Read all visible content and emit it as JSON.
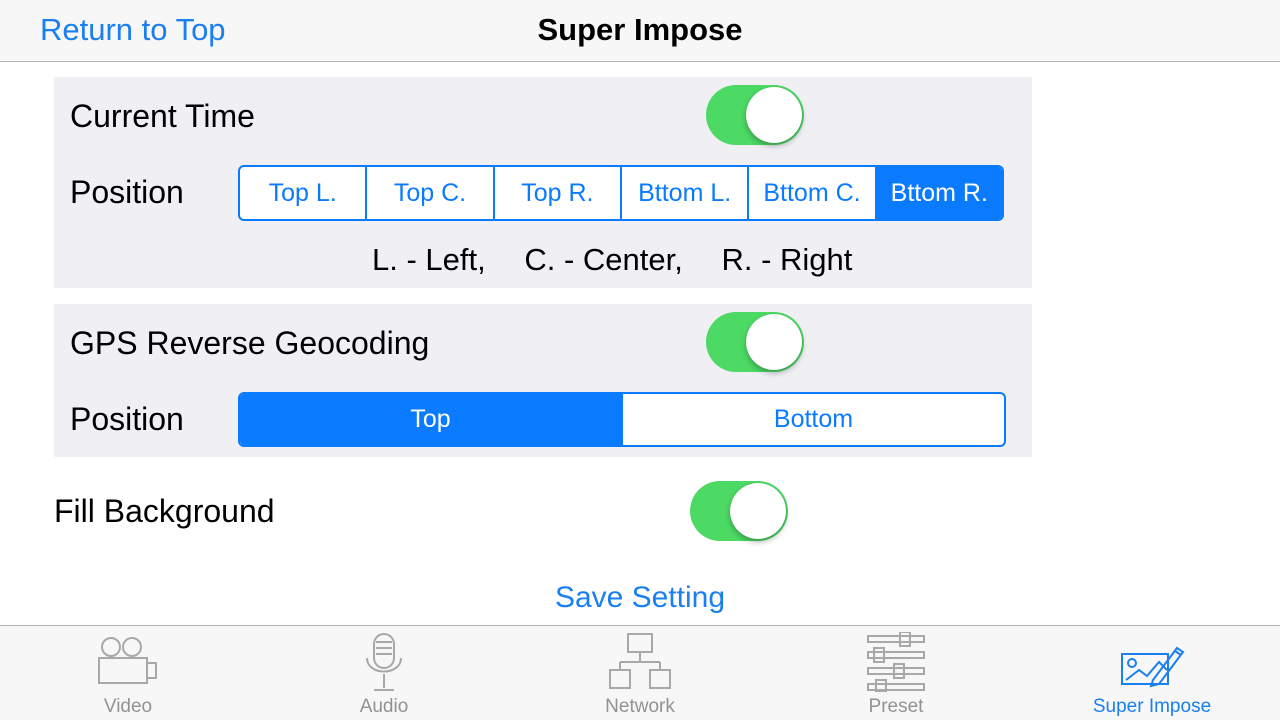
{
  "nav": {
    "back_label": "Return to Top",
    "title": "Super Impose"
  },
  "current_time": {
    "label": "Current Time",
    "enabled": true,
    "position_label": "Position",
    "position_options": [
      "Top L.",
      "Top C.",
      "Top R.",
      "Bttom L.",
      "Bttom C.",
      "Bttom R."
    ],
    "selected": "Bttom R.",
    "legend": [
      "L. - Left,",
      "C. - Center,",
      "R. - Right"
    ]
  },
  "gps": {
    "label": "GPS Reverse Geocoding",
    "enabled": true,
    "position_label": "Position",
    "position_options": [
      "Top",
      "Bottom"
    ],
    "selected": "Top"
  },
  "fill_background": {
    "label": "Fill Background",
    "enabled": true
  },
  "save_label": "Save Setting",
  "tabs": [
    {
      "label": "Video",
      "icon": "video-camera-icon"
    },
    {
      "label": "Audio",
      "icon": "microphone-icon"
    },
    {
      "label": "Network",
      "icon": "network-icon"
    },
    {
      "label": "Preset",
      "icon": "sliders-icon"
    },
    {
      "label": "Super Impose",
      "icon": "super-impose-icon"
    }
  ],
  "active_tab": "Super Impose",
  "colors": {
    "accent": "#0a7bff",
    "toggle_on": "#4cd964",
    "group_bg": "#efeff4",
    "tab_inactive": "#929292"
  }
}
